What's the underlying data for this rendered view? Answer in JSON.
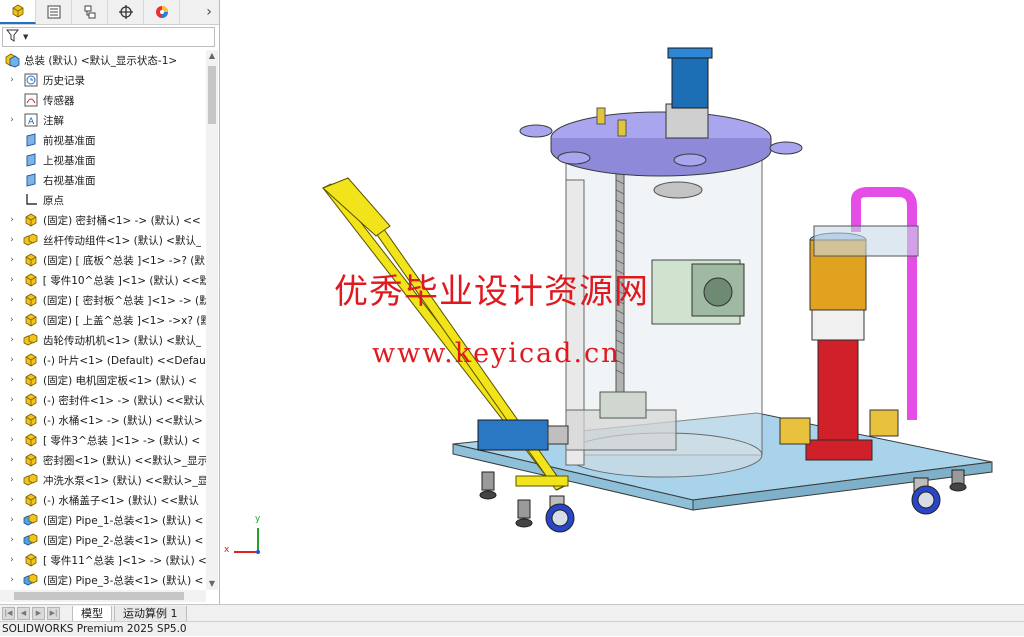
{
  "feature_tree": {
    "tabs": [
      {
        "name": "featuremanager-tab-icon"
      },
      {
        "name": "propertymanager-tab-icon"
      },
      {
        "name": "configurationmanager-tab-icon"
      },
      {
        "name": "dimxpert-tab-icon"
      },
      {
        "name": "display-manager-tab-icon"
      }
    ],
    "more_label": "›",
    "filter_label": "▼",
    "root": {
      "label": "总装 (默认) <默认_显示状态-1>"
    },
    "items": [
      {
        "label": "历史记录",
        "icon": "history-icon",
        "expand": "›"
      },
      {
        "label": "传感器",
        "icon": "sensor-icon",
        "expand": ""
      },
      {
        "label": "注解",
        "icon": "annotation-icon",
        "expand": "›"
      },
      {
        "label": "前视基准面",
        "icon": "plane-icon",
        "expand": ""
      },
      {
        "label": "上视基准面",
        "icon": "plane-icon",
        "expand": ""
      },
      {
        "label": "右视基准面",
        "icon": "plane-icon",
        "expand": ""
      },
      {
        "label": "原点",
        "icon": "origin-icon",
        "expand": ""
      },
      {
        "label": "(固定) 密封桶<1> -> (默认) <<",
        "icon": "part-icon",
        "expand": "›"
      },
      {
        "label": "丝杆传动组件<1> (默认) <默认_",
        "icon": "assembly-icon",
        "expand": "›"
      },
      {
        "label": "(固定) [ 底板^总装 ]<1> ->? (默",
        "icon": "part-icon",
        "expand": "›"
      },
      {
        "label": "[ 零件10^总装 ]<1> (默认) <<默",
        "icon": "part-icon",
        "expand": "›"
      },
      {
        "label": "(固定) [ 密封板^总装 ]<1> -> (默",
        "icon": "part-icon",
        "expand": "›"
      },
      {
        "label": "(固定) [ 上盖^总装 ]<1> ->x? (默",
        "icon": "part-icon",
        "expand": "›"
      },
      {
        "label": "齿轮传动机机<1> (默认) <默认_",
        "icon": "assembly-icon",
        "expand": "›"
      },
      {
        "label": "(-) 叶片<1> (Default) <<Defau",
        "icon": "part-icon",
        "expand": "›"
      },
      {
        "label": "(固定) 电机固定板<1> (默认) <",
        "icon": "part-icon",
        "expand": "›"
      },
      {
        "label": "(-) 密封件<1> -> (默认) <<默认",
        "icon": "part-icon",
        "expand": "›"
      },
      {
        "label": "(-) 水桶<1> -> (默认) <<默认>",
        "icon": "part-icon",
        "expand": "›"
      },
      {
        "label": "[ 零件3^总装 ]<1> -> (默认) <",
        "icon": "part-icon",
        "expand": "›"
      },
      {
        "label": "密封圈<1> (默认) <<默认>_显示",
        "icon": "part-icon",
        "expand": "›"
      },
      {
        "label": "冲洗水泵<1> (默认) <<默认>_显",
        "icon": "assembly-icon",
        "expand": "›"
      },
      {
        "label": "(-) 水桶盖子<1> (默认) <<默认",
        "icon": "part-icon",
        "expand": "›"
      },
      {
        "label": "(固定) Pipe_1-总装<1> (默认) <",
        "icon": "pipe-assembly-icon",
        "expand": "›"
      },
      {
        "label": "(固定) Pipe_2-总装<1> (默认) <",
        "icon": "pipe-assembly-icon",
        "expand": "›"
      },
      {
        "label": "[ 零件11^总装 ]<1> -> (默认) <",
        "icon": "part-icon",
        "expand": "›"
      },
      {
        "label": "(固定) Pipe_3-总装<1> (默认) <",
        "icon": "pipe-assembly-icon",
        "expand": "›"
      }
    ]
  },
  "bottom_tabs": {
    "model": "模型",
    "motion": "运动算例 1"
  },
  "status_bar": {
    "text": "SOLIDWORKS Premium 2025 SP5.0"
  },
  "viewport": {
    "watermark_line1": "优秀毕业设计资源网",
    "watermark_line2": "www.keyicad.cn",
    "triad": {
      "x": "x",
      "y": "y"
    }
  },
  "colors": {
    "accent": "#1e73c8",
    "watermark": "#e0191f",
    "platform": "#a8d3ea",
    "handle": "#f2e41a",
    "pump_red": "#d0202a",
    "pipe_magenta": "#e64de6",
    "lid": "#a9a6ef",
    "motor_blue": "#1d6fb5"
  }
}
